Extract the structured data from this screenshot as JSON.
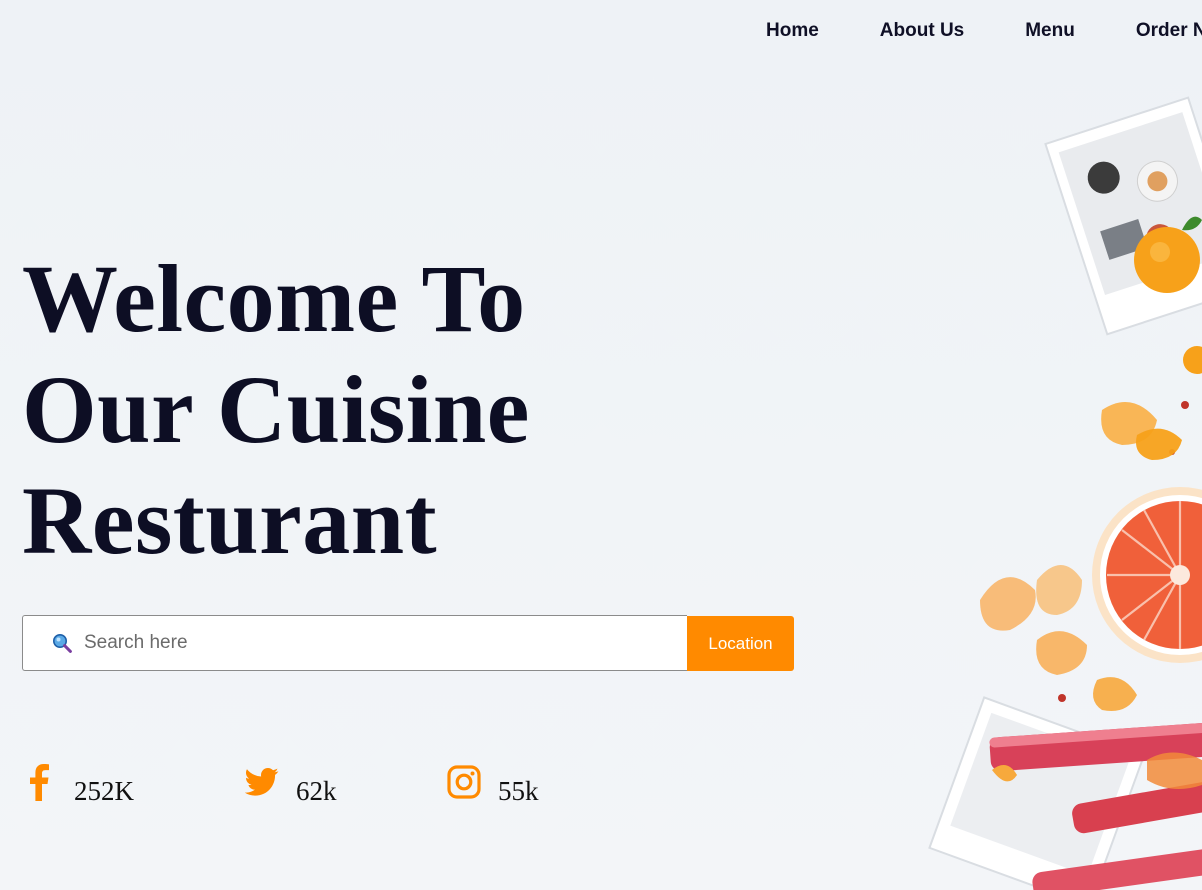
{
  "nav": {
    "items": [
      {
        "label": "Home"
      },
      {
        "label": "About Us"
      },
      {
        "label": "Menu"
      },
      {
        "label": "Order N"
      }
    ]
  },
  "hero": {
    "title_lines": [
      "Welcome To",
      "Our Cuisine",
      "Resturant"
    ]
  },
  "search": {
    "placeholder": "Search here",
    "value": "",
    "button_label": "Location"
  },
  "social": [
    {
      "network": "facebook",
      "icon": "facebook-icon",
      "count": "252K"
    },
    {
      "network": "twitter",
      "icon": "twitter-icon",
      "count": "62k"
    },
    {
      "network": "instagram",
      "icon": "instagram-icon",
      "count": "55k"
    }
  ],
  "colors": {
    "accent": "#ff8a00",
    "text": "#0d0e24",
    "background": "#eef2f6"
  }
}
